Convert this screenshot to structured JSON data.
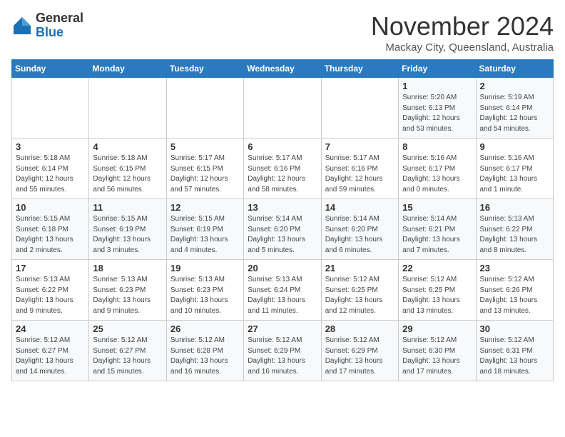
{
  "logo": {
    "general": "General",
    "blue": "Blue"
  },
  "title": "November 2024",
  "subtitle": "Mackay City, Queensland, Australia",
  "days_header": [
    "Sunday",
    "Monday",
    "Tuesday",
    "Wednesday",
    "Thursday",
    "Friday",
    "Saturday"
  ],
  "weeks": [
    [
      {
        "day": "",
        "info": ""
      },
      {
        "day": "",
        "info": ""
      },
      {
        "day": "",
        "info": ""
      },
      {
        "day": "",
        "info": ""
      },
      {
        "day": "",
        "info": ""
      },
      {
        "day": "1",
        "info": "Sunrise: 5:20 AM\nSunset: 6:13 PM\nDaylight: 12 hours\nand 53 minutes."
      },
      {
        "day": "2",
        "info": "Sunrise: 5:19 AM\nSunset: 6:14 PM\nDaylight: 12 hours\nand 54 minutes."
      }
    ],
    [
      {
        "day": "3",
        "info": "Sunrise: 5:18 AM\nSunset: 6:14 PM\nDaylight: 12 hours\nand 55 minutes."
      },
      {
        "day": "4",
        "info": "Sunrise: 5:18 AM\nSunset: 6:15 PM\nDaylight: 12 hours\nand 56 minutes."
      },
      {
        "day": "5",
        "info": "Sunrise: 5:17 AM\nSunset: 6:15 PM\nDaylight: 12 hours\nand 57 minutes."
      },
      {
        "day": "6",
        "info": "Sunrise: 5:17 AM\nSunset: 6:16 PM\nDaylight: 12 hours\nand 58 minutes."
      },
      {
        "day": "7",
        "info": "Sunrise: 5:17 AM\nSunset: 6:16 PM\nDaylight: 12 hours\nand 59 minutes."
      },
      {
        "day": "8",
        "info": "Sunrise: 5:16 AM\nSunset: 6:17 PM\nDaylight: 13 hours\nand 0 minutes."
      },
      {
        "day": "9",
        "info": "Sunrise: 5:16 AM\nSunset: 6:17 PM\nDaylight: 13 hours\nand 1 minute."
      }
    ],
    [
      {
        "day": "10",
        "info": "Sunrise: 5:15 AM\nSunset: 6:18 PM\nDaylight: 13 hours\nand 2 minutes."
      },
      {
        "day": "11",
        "info": "Sunrise: 5:15 AM\nSunset: 6:19 PM\nDaylight: 13 hours\nand 3 minutes."
      },
      {
        "day": "12",
        "info": "Sunrise: 5:15 AM\nSunset: 6:19 PM\nDaylight: 13 hours\nand 4 minutes."
      },
      {
        "day": "13",
        "info": "Sunrise: 5:14 AM\nSunset: 6:20 PM\nDaylight: 13 hours\nand 5 minutes."
      },
      {
        "day": "14",
        "info": "Sunrise: 5:14 AM\nSunset: 6:20 PM\nDaylight: 13 hours\nand 6 minutes."
      },
      {
        "day": "15",
        "info": "Sunrise: 5:14 AM\nSunset: 6:21 PM\nDaylight: 13 hours\nand 7 minutes."
      },
      {
        "day": "16",
        "info": "Sunrise: 5:13 AM\nSunset: 6:22 PM\nDaylight: 13 hours\nand 8 minutes."
      }
    ],
    [
      {
        "day": "17",
        "info": "Sunrise: 5:13 AM\nSunset: 6:22 PM\nDaylight: 13 hours\nand 9 minutes."
      },
      {
        "day": "18",
        "info": "Sunrise: 5:13 AM\nSunset: 6:23 PM\nDaylight: 13 hours\nand 9 minutes."
      },
      {
        "day": "19",
        "info": "Sunrise: 5:13 AM\nSunset: 6:23 PM\nDaylight: 13 hours\nand 10 minutes."
      },
      {
        "day": "20",
        "info": "Sunrise: 5:13 AM\nSunset: 6:24 PM\nDaylight: 13 hours\nand 11 minutes."
      },
      {
        "day": "21",
        "info": "Sunrise: 5:12 AM\nSunset: 6:25 PM\nDaylight: 13 hours\nand 12 minutes."
      },
      {
        "day": "22",
        "info": "Sunrise: 5:12 AM\nSunset: 6:25 PM\nDaylight: 13 hours\nand 13 minutes."
      },
      {
        "day": "23",
        "info": "Sunrise: 5:12 AM\nSunset: 6:26 PM\nDaylight: 13 hours\nand 13 minutes."
      }
    ],
    [
      {
        "day": "24",
        "info": "Sunrise: 5:12 AM\nSunset: 6:27 PM\nDaylight: 13 hours\nand 14 minutes."
      },
      {
        "day": "25",
        "info": "Sunrise: 5:12 AM\nSunset: 6:27 PM\nDaylight: 13 hours\nand 15 minutes."
      },
      {
        "day": "26",
        "info": "Sunrise: 5:12 AM\nSunset: 6:28 PM\nDaylight: 13 hours\nand 16 minutes."
      },
      {
        "day": "27",
        "info": "Sunrise: 5:12 AM\nSunset: 6:29 PM\nDaylight: 13 hours\nand 16 minutes."
      },
      {
        "day": "28",
        "info": "Sunrise: 5:12 AM\nSunset: 6:29 PM\nDaylight: 13 hours\nand 17 minutes."
      },
      {
        "day": "29",
        "info": "Sunrise: 5:12 AM\nSunset: 6:30 PM\nDaylight: 13 hours\nand 17 minutes."
      },
      {
        "day": "30",
        "info": "Sunrise: 5:12 AM\nSunset: 6:31 PM\nDaylight: 13 hours\nand 18 minutes."
      }
    ]
  ]
}
